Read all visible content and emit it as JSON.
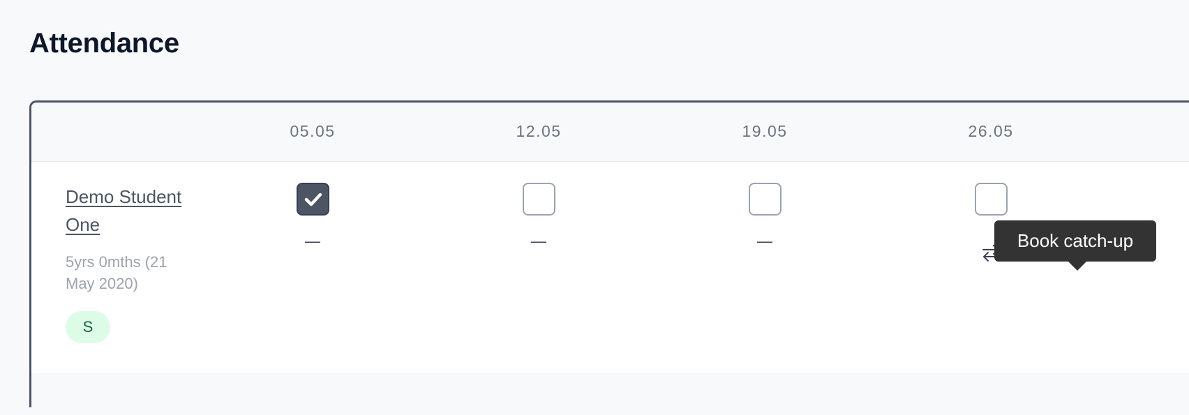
{
  "page": {
    "title": "Attendance"
  },
  "table": {
    "dates": [
      "05.05",
      "12.05",
      "19.05",
      "26.05"
    ],
    "student": {
      "name": "Demo Student One",
      "age": "5yrs 0mths (21 May 2020)",
      "badge": "S"
    },
    "cells": [
      {
        "checked": true,
        "status": "—"
      },
      {
        "checked": false,
        "status": "—"
      },
      {
        "checked": false,
        "status": "—"
      },
      {
        "checked": false,
        "status": ""
      }
    ]
  },
  "tooltip": {
    "text": "Book catch-up"
  },
  "icons": {
    "check": "check-icon",
    "catchup": "arrows-swap-icon"
  },
  "colors": {
    "checked_fill": "#4b5563",
    "badge_bg": "#dcfce7",
    "badge_text": "#166534",
    "tooltip_bg": "#333333"
  }
}
